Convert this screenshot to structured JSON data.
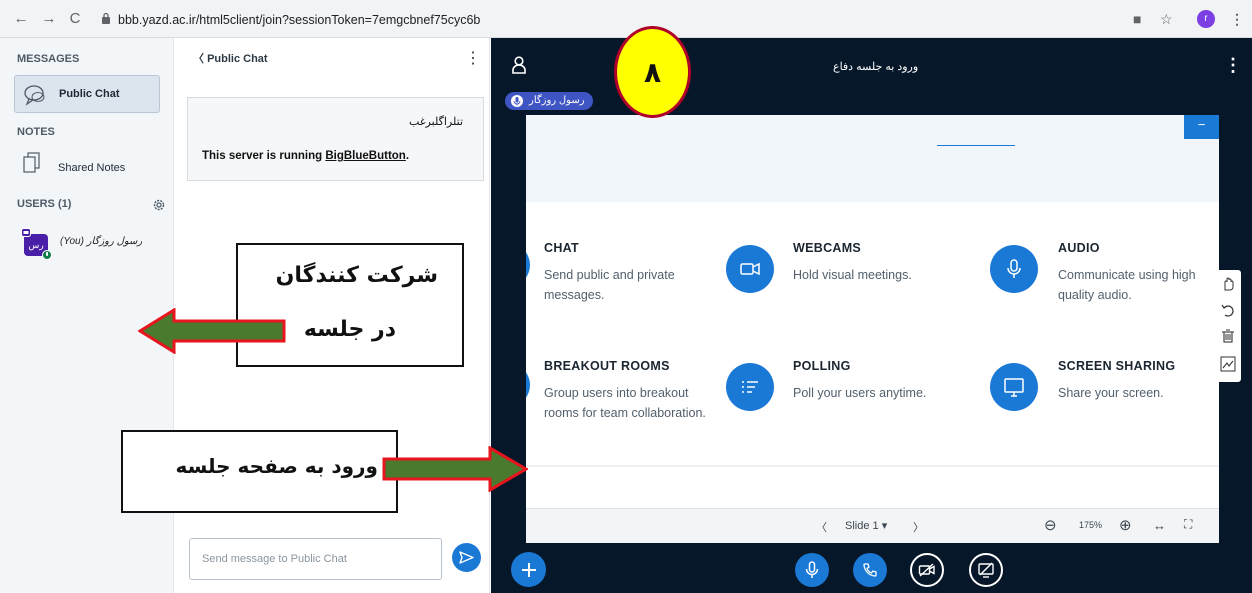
{
  "browser": {
    "url": "bbb.yazd.ac.ir/html5client/join?sessionToken=7emgcbnef75cyc6b",
    "profile_initial": "r",
    "back_icon": "arrow-left-icon",
    "forward_icon": "arrow-right-icon",
    "reload_icon": "reload-icon"
  },
  "sidebar": {
    "messages_title": "MESSAGES",
    "public_chat": "Public Chat",
    "notes_title": "NOTES",
    "shared_notes": "Shared Notes",
    "users_title": "USERS (1)",
    "user": {
      "avatar_text": "رس",
      "name": "رسول روزگار",
      "you_tag": "(You)"
    }
  },
  "chat": {
    "header": "Public Chat",
    "welcome_rtl": "تتلراگلبرغب",
    "server_text_prefix": "This server is running ",
    "server_link": "BigBlueButton",
    "server_text_suffix": ".",
    "input_placeholder": "Send message to Public Chat"
  },
  "meeting": {
    "title": "ورود به جلسه دفاع",
    "talker_name": "رسول روزگار",
    "slide": {
      "corner_label": "−",
      "features": [
        {
          "title": "CHAT",
          "desc": "Send public and private messages."
        },
        {
          "title": "WEBCAMS",
          "desc": "Hold visual meetings."
        },
        {
          "title": "AUDIO",
          "desc": "Communicate using high quality audio."
        },
        {
          "title": "BREAKOUT ROOMS",
          "desc": "Group users into breakout rooms for team collaboration."
        },
        {
          "title": "POLLING",
          "desc": "Poll your users anytime."
        },
        {
          "title": "SCREEN SHARING",
          "desc": "Share your screen."
        }
      ],
      "nav": {
        "prev": "〈",
        "slide_label": "Slide 1",
        "dropdown": "▾",
        "next": "〉",
        "zoom_out": "⊖",
        "zoom": "175%",
        "zoom_in": "⊕",
        "fit_width": "↔",
        "fullscreen": "⛶"
      }
    }
  },
  "annotations": {
    "step_number": "۸",
    "participants_line1": "شرکت کنندگان",
    "participants_line2": "در جلسه",
    "enter_meeting": "ورود به صفحه جلسه",
    "colors": {
      "arrow_fill": "#4a7a2e",
      "arrow_border": "#e8141e",
      "circle_fill": "#ffff00",
      "circle_border": "#b0002a"
    }
  },
  "colors": {
    "accent": "#1b79d6",
    "meeting_bg": "#06172a",
    "sidebar_bg": "#f3f6f9"
  }
}
